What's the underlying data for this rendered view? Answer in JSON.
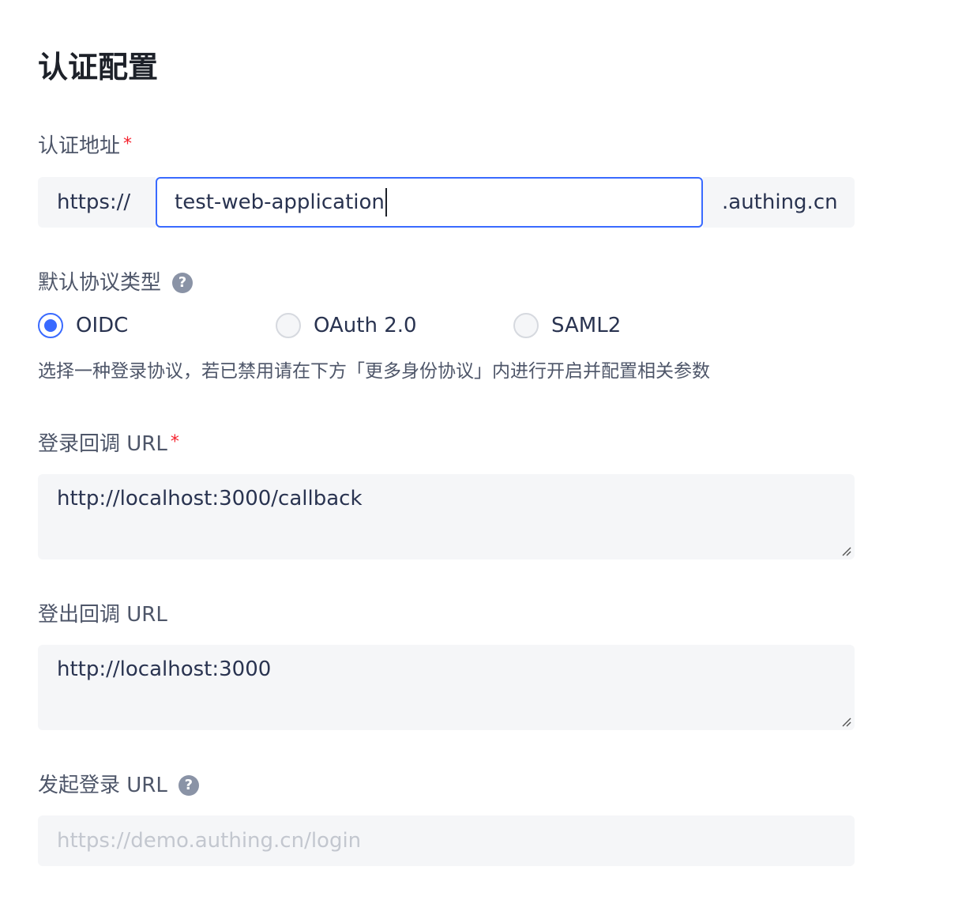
{
  "title": "认证配置",
  "auth_address": {
    "label": "认证地址",
    "required_mark": "*",
    "prefix": "https://",
    "value": "test-web-application",
    "suffix": ".authing.cn"
  },
  "protocol": {
    "label": "默认协议类型",
    "help_icon": "question-circle-icon",
    "help_glyph": "?",
    "options": [
      {
        "label": "OIDC",
        "selected": true
      },
      {
        "label": "OAuth 2.0",
        "selected": false
      },
      {
        "label": "SAML2",
        "selected": false
      }
    ],
    "hint": "选择一种登录协议，若已禁用请在下方「更多身份协议」内进行开启并配置相关参数"
  },
  "login_callback": {
    "label": "登录回调 URL",
    "required_mark": "*",
    "value": "http://localhost:3000/callback"
  },
  "logout_callback": {
    "label": "登出回调 URL",
    "value": "http://localhost:3000"
  },
  "initiate_login": {
    "label": "发起登录 URL",
    "help_glyph": "?",
    "placeholder": "https://demo.authing.cn/login"
  },
  "colors": {
    "accent": "#396aff",
    "required": "#f5222d",
    "input_bg": "#f5f6f8"
  }
}
